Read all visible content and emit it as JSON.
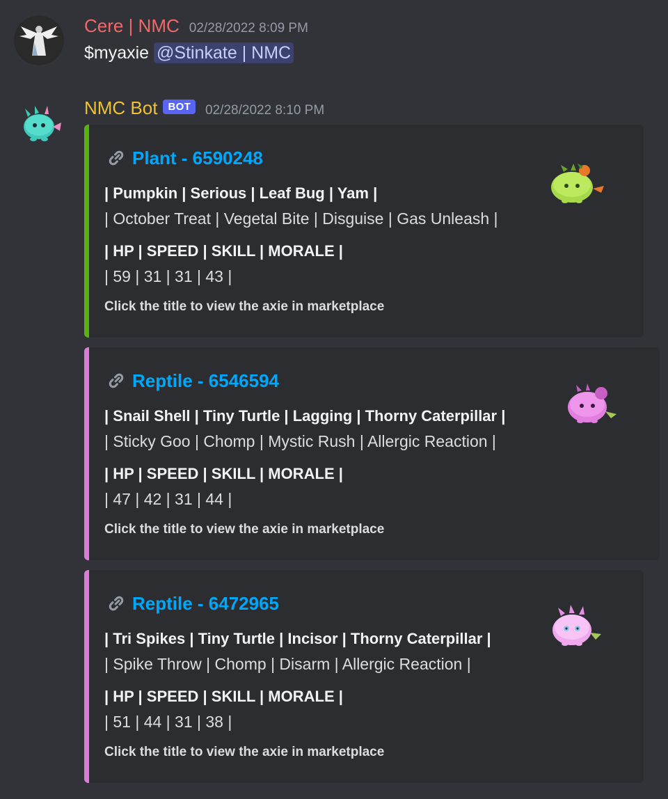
{
  "messages": [
    {
      "username": "Cere | NMC",
      "username_color": "#f0686a",
      "timestamp": "02/28/2022 8:09 PM",
      "content_prefix": "$myaxie ",
      "mention": "@Stinkate | NMC"
    },
    {
      "username": "NMC Bot",
      "username_color": "#f0c231",
      "bot_tag": "BOT",
      "timestamp": "02/28/2022 8:10 PM",
      "embeds": [
        {
          "accent_color": "#57b214",
          "title": "Plant - 6590248",
          "parts": "| Pumpkin | Serious | Leaf Bug | Yam |",
          "abilities": "| October Treat | Vegetal Bite | Disguise | Gas Unleash |",
          "stats_header": "| HP | SPEED | SKILL | MORALE |",
          "stats": "| 59 | 31 | 31 | 43 |",
          "footer": "Click the title to view the axie in marketplace",
          "thumb_icon": "plant-axie-icon"
        },
        {
          "accent_color": "#dc7cd8",
          "title": "Reptile - 6546594",
          "parts": "| Snail Shell | Tiny Turtle | Lagging | Thorny Caterpillar |",
          "abilities": "| Sticky Goo | Chomp | Mystic Rush | Allergic Reaction |",
          "stats_header": "| HP | SPEED | SKILL | MORALE |",
          "stats": "| 47 | 42 | 31 | 44 |",
          "footer": "Click the title to view the axie in marketplace",
          "thumb_icon": "reptile-axie-icon"
        },
        {
          "accent_color": "#dc7cd8",
          "title": "Reptile - 6472965",
          "parts": "| Tri Spikes | Tiny Turtle | Incisor | Thorny Caterpillar |",
          "abilities": "| Spike Throw | Chomp | Disarm | Allergic Reaction |",
          "stats_header": "| HP | SPEED | SKILL | MORALE |",
          "stats": "| 51 | 44 | 31 | 38 |",
          "footer": "Click the title to view the axie in marketplace",
          "thumb_icon": "reptile-axie-icon"
        }
      ]
    }
  ]
}
